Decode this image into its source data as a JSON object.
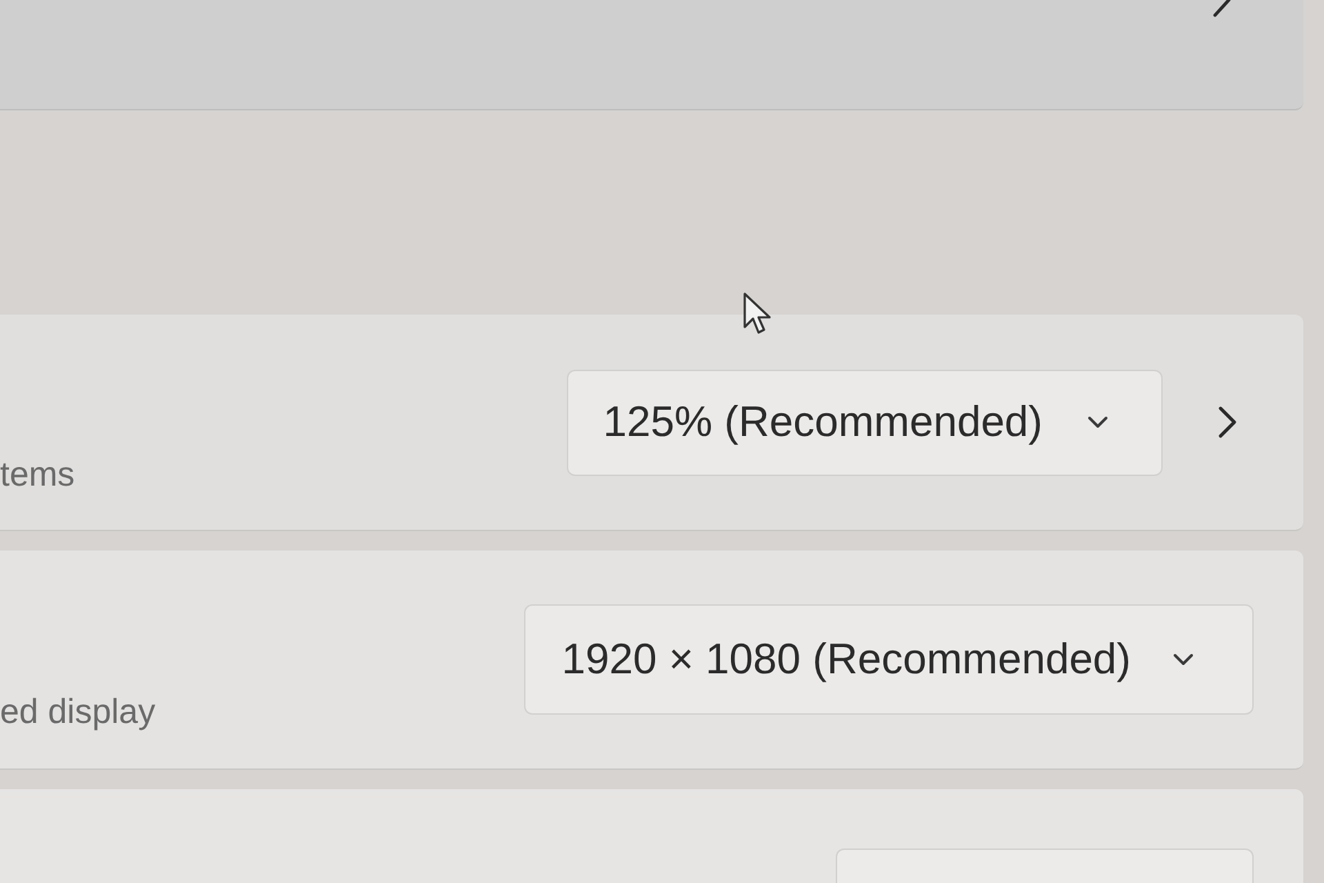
{
  "sections": [
    {
      "rows": [
        {
          "kind": "navigation"
        }
      ]
    },
    {
      "rows": [
        {
          "kind": "dropdown",
          "description": "tems",
          "dropdown": {
            "value": "125% (Recommended)"
          },
          "navigation": true
        },
        {
          "kind": "dropdown",
          "description": "ed display",
          "dropdown": {
            "value": "1920 × 1080 (Recommended)"
          },
          "navigation": false
        },
        {
          "kind": "dropdown_partial"
        }
      ]
    }
  ]
}
